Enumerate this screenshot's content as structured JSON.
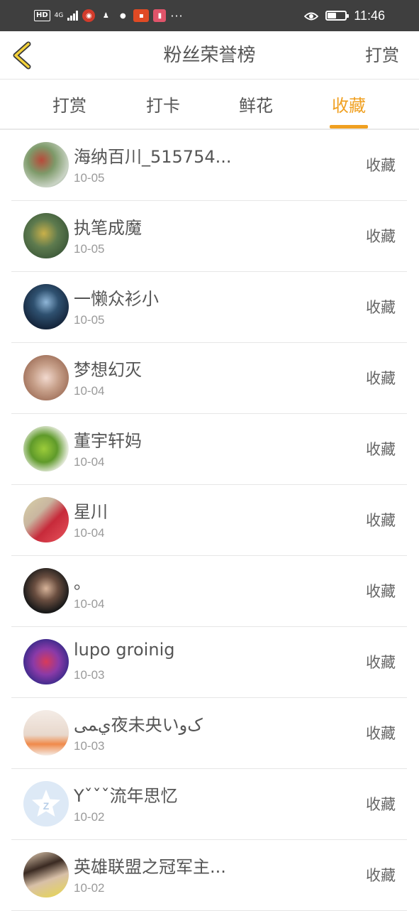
{
  "status_bar": {
    "network": "HD",
    "network_gen": "4G",
    "more": "···",
    "time": "11:46"
  },
  "header": {
    "title": "粉丝荣誉榜",
    "action": "打赏",
    "back_icon": "chevron-left-icon",
    "accent_color": "#f0a021"
  },
  "tabs": [
    {
      "label": "打赏",
      "active": false
    },
    {
      "label": "打卡",
      "active": false
    },
    {
      "label": "鲜花",
      "active": false
    },
    {
      "label": "收藏",
      "active": true
    }
  ],
  "fans": [
    {
      "name": "海纳百川_515754...",
      "date": "10-05",
      "action": "收藏"
    },
    {
      "name": "执笔成魔",
      "date": "10-05",
      "action": "收藏"
    },
    {
      "name": "一懒众衫小",
      "date": "10-05",
      "action": "收藏"
    },
    {
      "name": "梦想幻灭",
      "date": "10-04",
      "action": "收藏"
    },
    {
      "name": "董宇轩妈",
      "date": "10-04",
      "action": "收藏"
    },
    {
      "name": "星川",
      "date": "10-04",
      "action": "收藏"
    },
    {
      "name": "。",
      "date": "10-04",
      "action": "收藏"
    },
    {
      "name": "lupo groinig",
      "date": "10-03",
      "action": "收藏"
    },
    {
      "name": "ﻱﻤﻰ夜未央いکﻭ",
      "date": "10-03",
      "action": "收藏"
    },
    {
      "name": "Yˇˇˇ流年思忆",
      "date": "10-02",
      "action": "收藏"
    },
    {
      "name": "英雄联盟之冠军主...",
      "date": "10-02",
      "action": "收藏"
    }
  ]
}
